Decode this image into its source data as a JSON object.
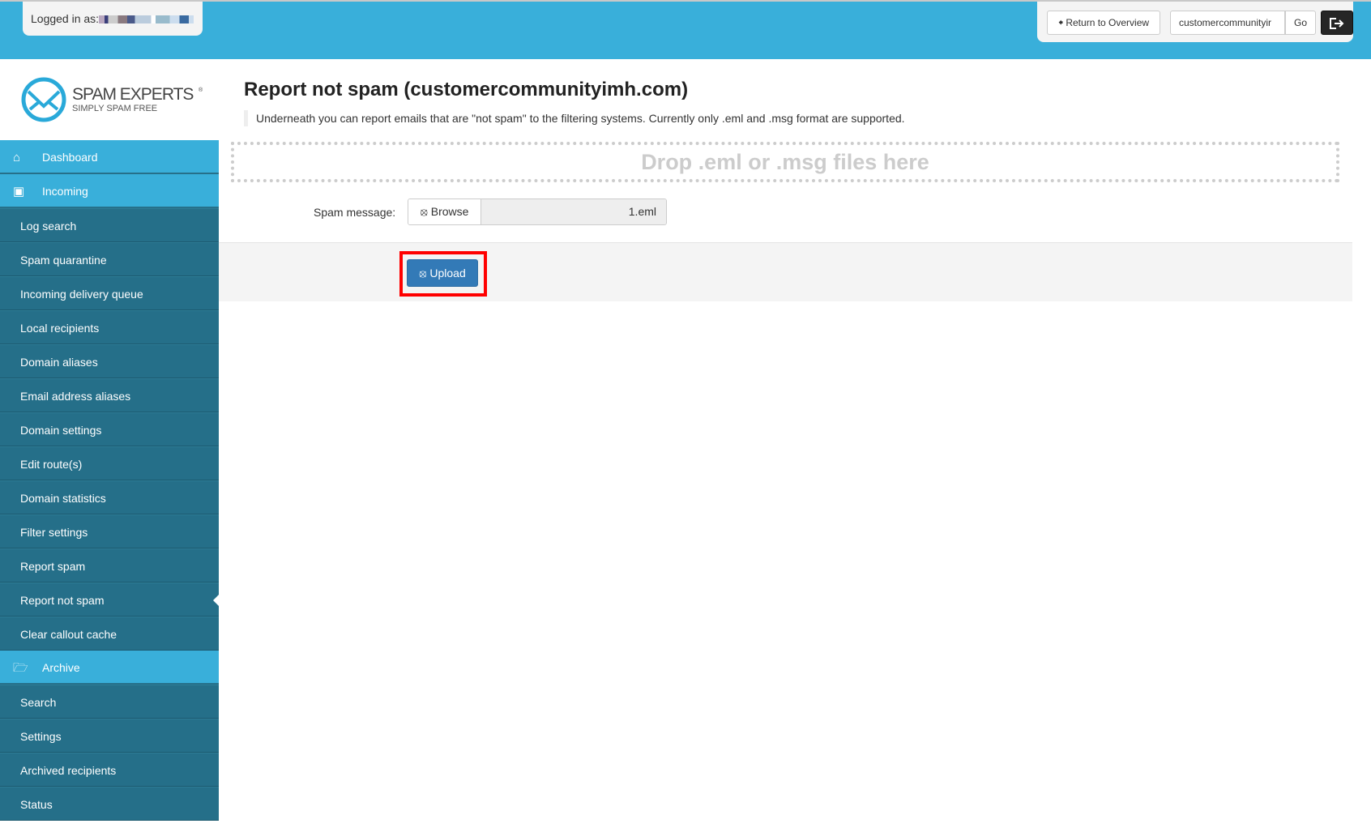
{
  "header": {
    "logged_in_label": "Logged in as:",
    "return_label": "Return to Overview",
    "domain_input": "customercommunityir",
    "go_label": "Go"
  },
  "logo": {
    "name": "SPAM EXPERTS",
    "tagline": "SIMPLY SPAM FREE"
  },
  "sidebar": {
    "items": [
      {
        "label": "Dashboard",
        "type": "top",
        "icon": "home-icon"
      },
      {
        "label": "Incoming",
        "type": "top",
        "icon": "inbox-icon"
      },
      {
        "label": "Log search",
        "type": "sub"
      },
      {
        "label": "Spam quarantine",
        "type": "sub"
      },
      {
        "label": "Incoming delivery queue",
        "type": "sub"
      },
      {
        "label": "Local recipients",
        "type": "sub"
      },
      {
        "label": "Domain aliases",
        "type": "sub"
      },
      {
        "label": "Email address aliases",
        "type": "sub"
      },
      {
        "label": "Domain settings",
        "type": "sub"
      },
      {
        "label": "Edit route(s)",
        "type": "sub"
      },
      {
        "label": "Domain statistics",
        "type": "sub"
      },
      {
        "label": "Filter settings",
        "type": "sub"
      },
      {
        "label": "Report spam",
        "type": "sub"
      },
      {
        "label": "Report not spam",
        "type": "sub",
        "active": true
      },
      {
        "label": "Clear callout cache",
        "type": "sub"
      },
      {
        "label": "Archive",
        "type": "top",
        "icon": "folder-open-icon"
      },
      {
        "label": "Search",
        "type": "sub"
      },
      {
        "label": "Settings",
        "type": "sub"
      },
      {
        "label": "Archived recipients",
        "type": "sub"
      },
      {
        "label": "Status",
        "type": "sub"
      }
    ]
  },
  "main": {
    "title": "Report not spam (customercommunityimh.com)",
    "description": "Underneath you can report emails that are \"not spam\" to the filtering systems. Currently only .eml and .msg format are supported.",
    "drop_text": "Drop .eml or .msg files here",
    "field_label": "Spam message:",
    "browse_label": "Browse",
    "file_name": "1.eml",
    "upload_label": "Upload"
  }
}
